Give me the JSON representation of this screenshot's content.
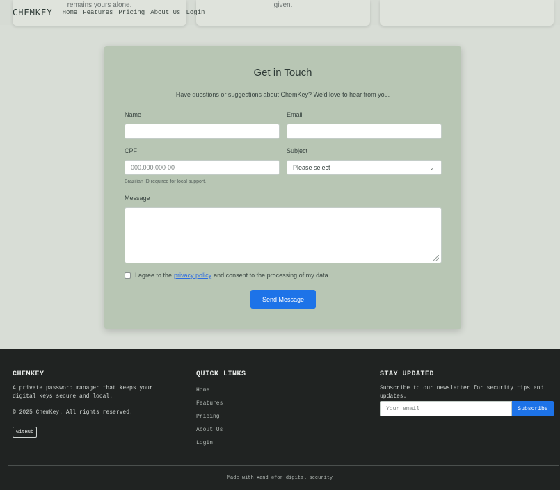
{
  "top_cards": [
    {
      "text": "remains yours alone."
    },
    {
      "text": "given."
    },
    {
      "text": ""
    }
  ],
  "nav": {
    "logo": "CHEMKEY",
    "links": [
      "Home",
      "Features",
      "Pricing",
      "About Us",
      "Login"
    ]
  },
  "contact": {
    "title": "Get in Touch",
    "subtitle": "Have questions or suggestions about ChemKey? We'd love to hear from you.",
    "name_label": "Name",
    "email_label": "Email",
    "cpf_label": "CPF",
    "cpf_placeholder": "000.000.000-00",
    "cpf_hint": "Brazilian ID required for local support.",
    "subject_label": "Subject",
    "subject_selected": "Please select",
    "message_label": "Message",
    "consent_prefix": "I agree to the",
    "consent_link": "privacy policy",
    "consent_suffix": "and consent to the processing of my data.",
    "send_label": "Send Message"
  },
  "footer": {
    "brand": "CHEMKEY",
    "description": "A private password manager that keeps your digital keys secure and local.",
    "copyright": "© 2025 ChemKey. All rights reserved.",
    "github": "GitHub",
    "quick_links_title": "QUICK LINKS",
    "quick_links": [
      "Home",
      "Features",
      "Pricing",
      "About Us",
      "Login"
    ],
    "newsletter_title": "STAY UPDATED",
    "newsletter_text": "Subscribe to our newsletter for security tips and updates.",
    "newsletter_placeholder": "Your email",
    "subscribe_label": "Subscribe",
    "made_with": "Made with ❤and ☮for digital security"
  },
  "colors": {
    "accent": "#1d73e8",
    "card": "#b8c6b4",
    "footer_bg": "#202322"
  }
}
